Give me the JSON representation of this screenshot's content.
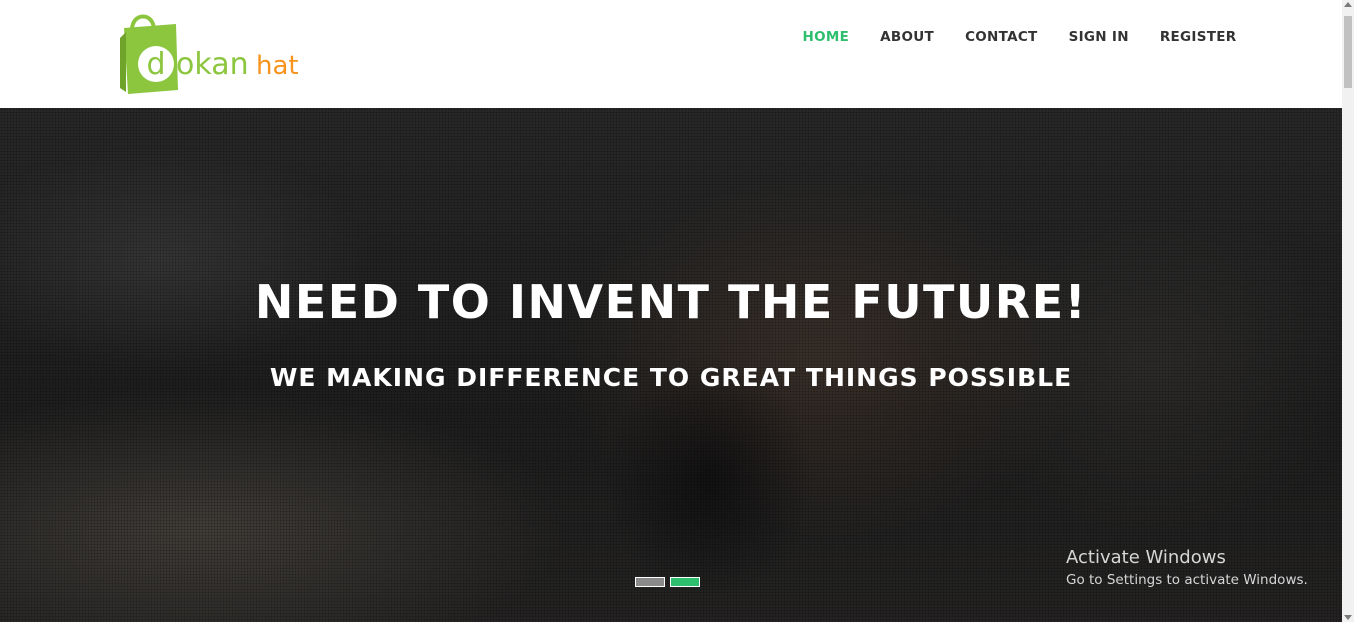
{
  "brand": {
    "logo_text_d": "d",
    "logo_text_okan": "okan",
    "logo_text_hat": "hat",
    "green": "#8cc63f",
    "orange": "#f7941d"
  },
  "nav": {
    "items": [
      {
        "label": "HOME",
        "active": true
      },
      {
        "label": "ABOUT",
        "active": false
      },
      {
        "label": "CONTACT",
        "active": false
      },
      {
        "label": "SIGN IN",
        "active": false
      },
      {
        "label": "REGISTER",
        "active": false
      }
    ],
    "active_color": "#2ebf6e"
  },
  "hero": {
    "title": "NEED TO INVENT THE FUTURE!",
    "subtitle": "WE MAKING DIFFERENCE TO GREAT THINGS POSSIBLE",
    "slides_count": 2,
    "active_slide": 2
  },
  "watermark": {
    "title": "Activate Windows",
    "subtitle": "Go to Settings to activate Windows."
  }
}
